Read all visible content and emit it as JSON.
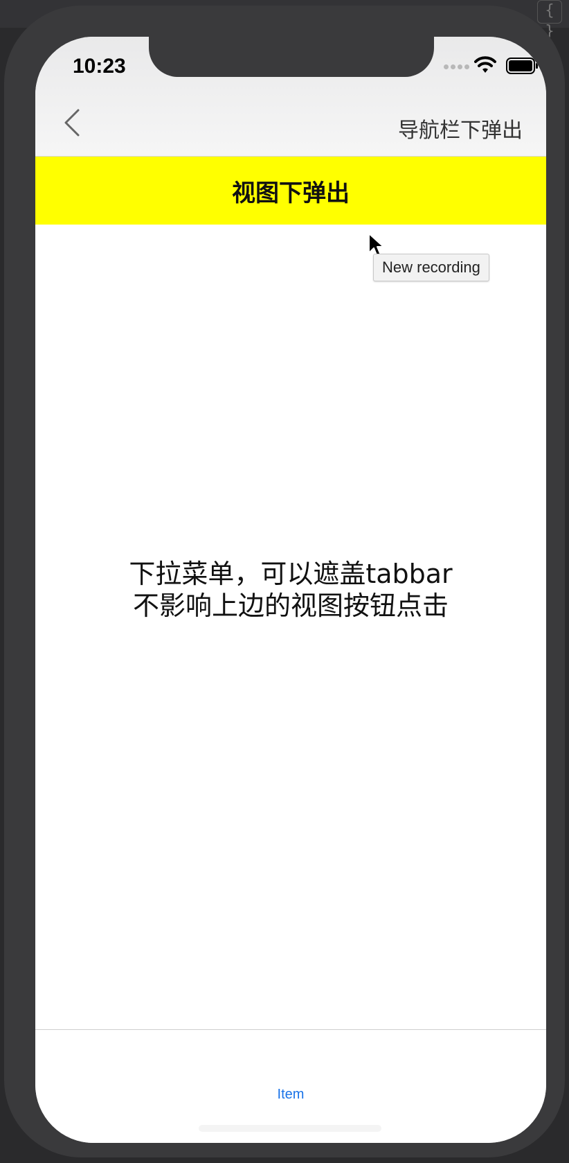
{
  "status": {
    "time": "10:23"
  },
  "nav": {
    "title": "导航栏下弹出"
  },
  "banner": {
    "title": "视图下弹出"
  },
  "tooltip": {
    "text": "New recording"
  },
  "content": {
    "line1": "下拉菜单，可以遮盖tabbar",
    "line2": "不影响上边的视图按钮点击"
  },
  "tabbar": {
    "item_label": "Item"
  },
  "colors": {
    "banner": "#ffff00",
    "tab_active": "#1a73e8"
  }
}
